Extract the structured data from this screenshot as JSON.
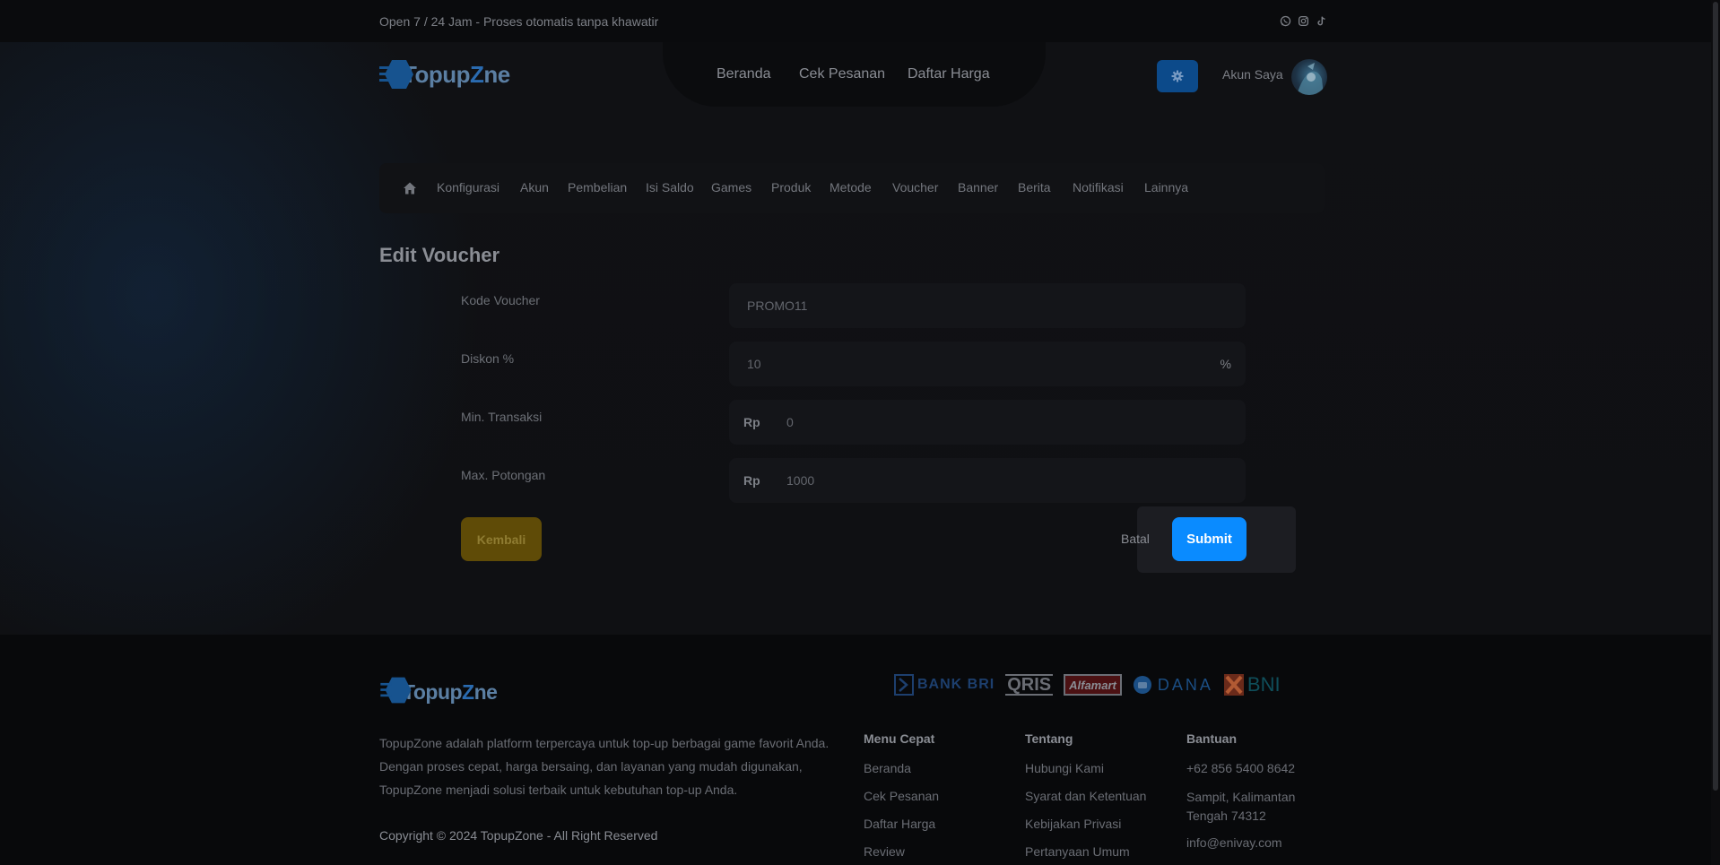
{
  "topbar": {
    "tagline": "Open 7 / 24 Jam - Proses otomatis tanpa khawatir",
    "socials": [
      "whatsapp-icon",
      "instagram-icon",
      "tiktok-icon"
    ]
  },
  "brand": {
    "name_part1": "Topup",
    "name_z": "Z",
    "name_part2": "ne"
  },
  "nav": {
    "home": "Beranda",
    "check_order": "Cek Pesanan",
    "price_list": "Daftar Harga"
  },
  "account": {
    "label": "Akun Saya"
  },
  "admin_menu": {
    "items": [
      "Konfigurasi",
      "Akun",
      "Pembelian",
      "Isi Saldo",
      "Games",
      "Produk",
      "Metode",
      "Voucher",
      "Banner",
      "Berita",
      "Notifikasi",
      "Lainnya"
    ]
  },
  "page": {
    "title": "Edit Voucher"
  },
  "form": {
    "code_label": "Kode Voucher",
    "code_value": "PROMO11",
    "discount_label": "Diskon %",
    "discount_value": "10",
    "discount_suffix": "%",
    "min_label": "Min. Transaksi",
    "min_prefix": "Rp",
    "min_value": "0",
    "max_label": "Max. Potongan",
    "max_prefix": "Rp",
    "max_value": "1000",
    "back_label": "Kembali",
    "cancel_label": "Batal",
    "submit_label": "Submit"
  },
  "footer": {
    "payments": {
      "bri": "BANK BRI",
      "qris": "QRIS",
      "alfamart": "Alfamart",
      "dana": "DANA",
      "bni": "BNI"
    },
    "description": "TopupZone adalah platform terpercaya untuk top-up berbagai game favorit Anda. Dengan proses cepat, harga bersaing, dan layanan yang mudah digunakan, TopupZone menjadi solusi terbaik untuk kebutuhan top-up Anda.",
    "copyright": "Copyright © 2024 TopupZone - All Right Reserved",
    "quick_menu": {
      "title": "Menu Cepat",
      "links": [
        "Beranda",
        "Cek Pesanan",
        "Daftar Harga",
        "Review"
      ]
    },
    "about": {
      "title": "Tentang",
      "links": [
        "Hubungi Kami",
        "Syarat dan Ketentuan",
        "Kebijakan Privasi",
        "Pertanyaan Umum"
      ]
    },
    "help": {
      "title": "Bantuan",
      "phone": "+62 856 5400 8642",
      "address": "Sampit, Kalimantan Tengah 74312",
      "email": "info@enivay.com"
    }
  },
  "colors": {
    "primary": "#0a8bff",
    "back_button": "#5f4b07",
    "gear_button": "#0c4a8a",
    "background": "#0d0e11"
  }
}
